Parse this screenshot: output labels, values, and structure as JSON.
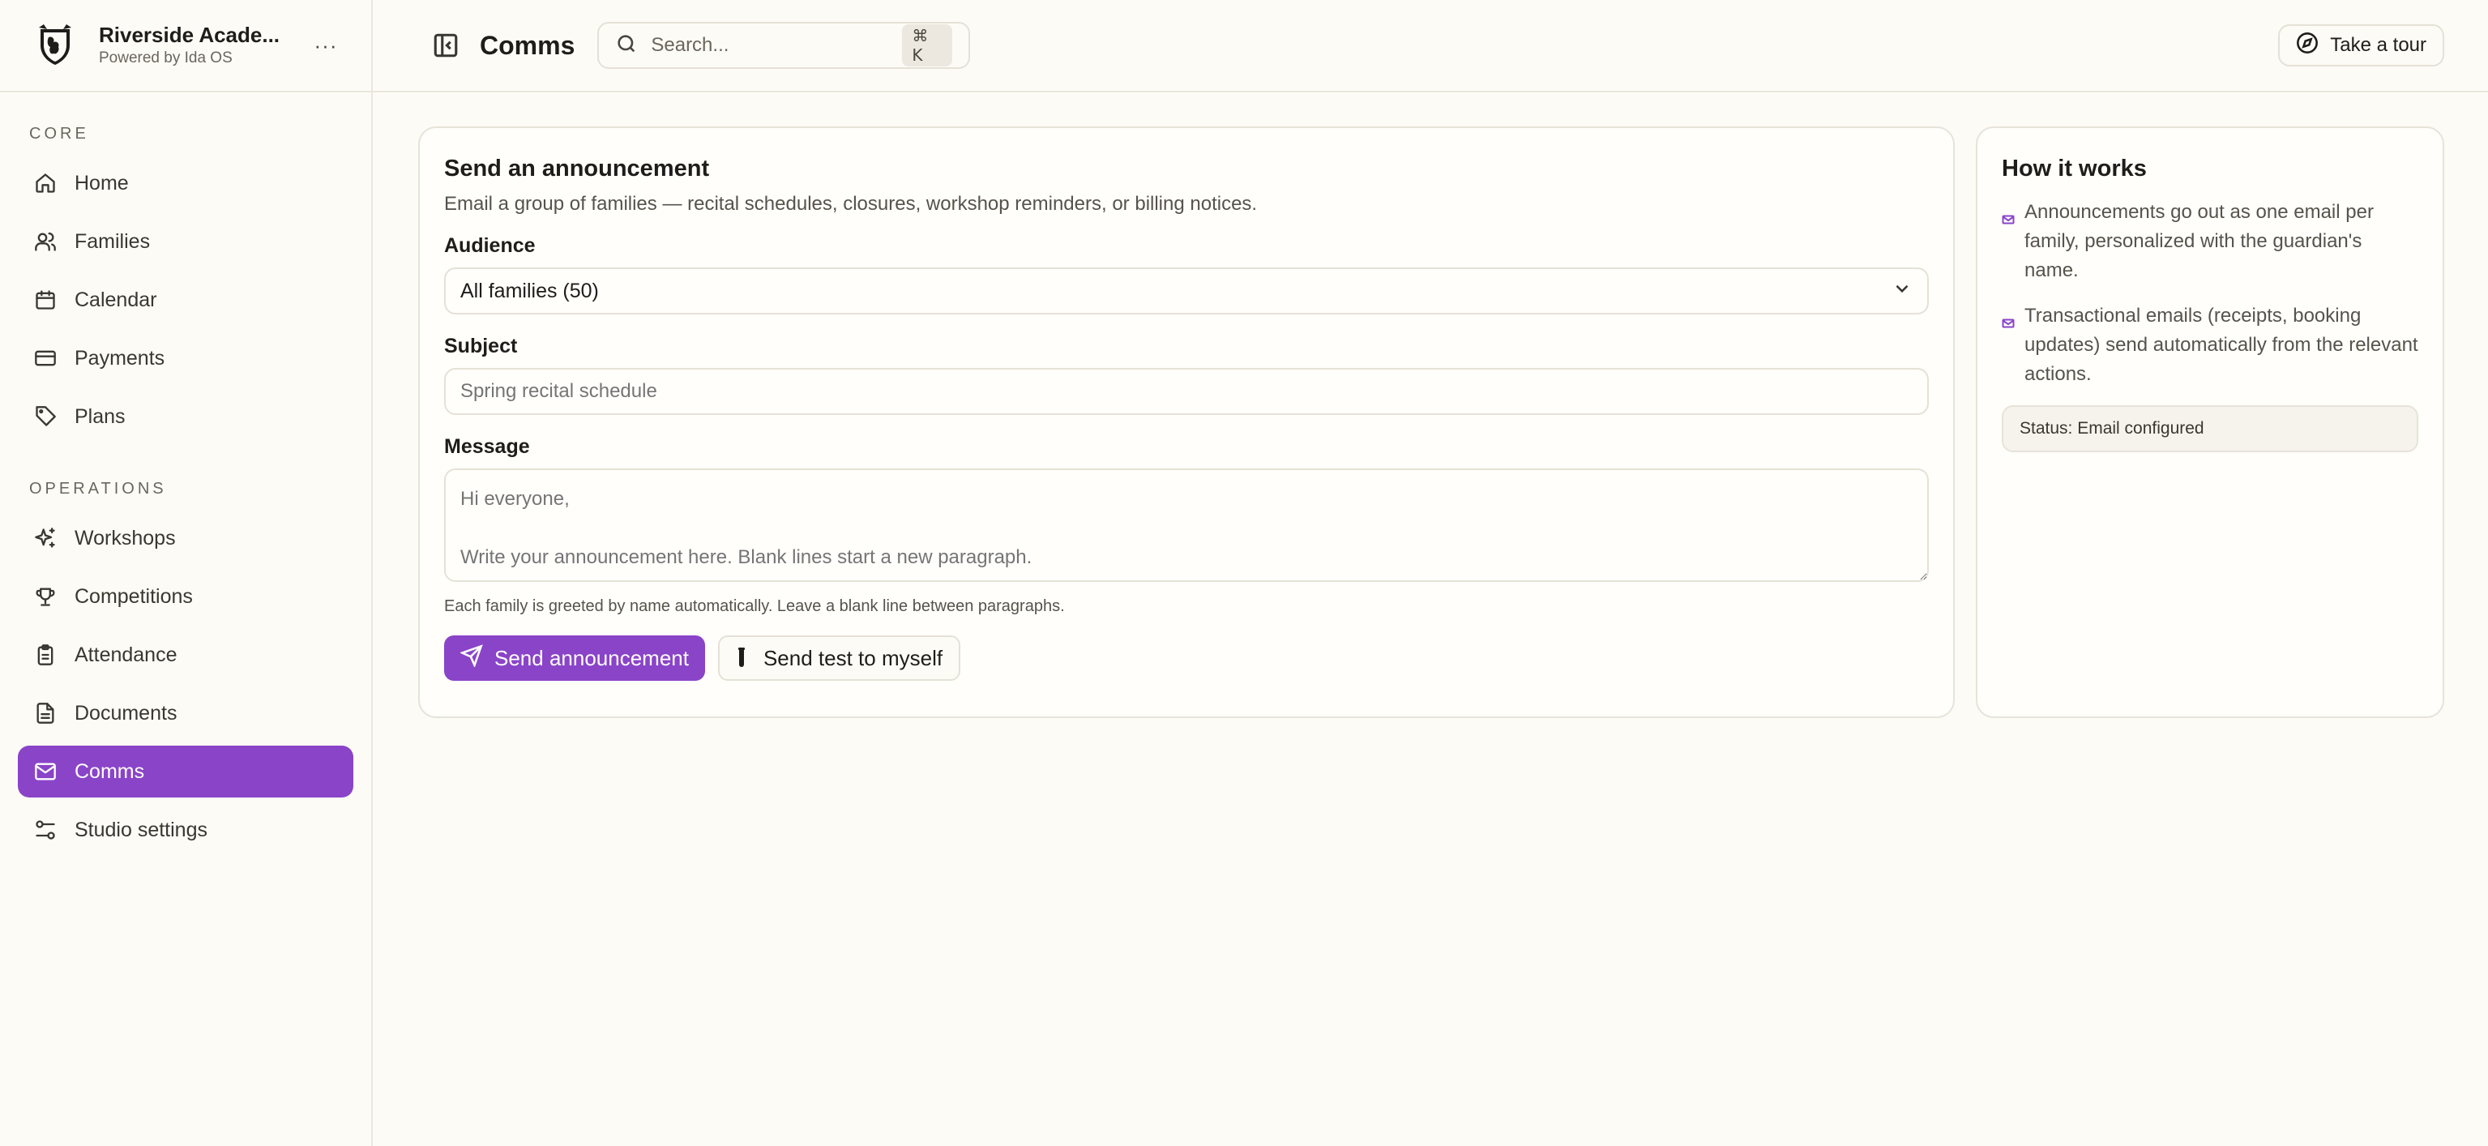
{
  "brand": {
    "name": "Riverside Acade...",
    "subtitle": "Powered by Ida OS",
    "more_label": "···"
  },
  "sidebar": {
    "core_label": "CORE",
    "core_items": [
      {
        "label": "Home",
        "icon": "home-icon"
      },
      {
        "label": "Families",
        "icon": "users-icon"
      },
      {
        "label": "Calendar",
        "icon": "calendar-icon"
      },
      {
        "label": "Payments",
        "icon": "credit-card-icon"
      },
      {
        "label": "Plans",
        "icon": "tag-icon"
      }
    ],
    "ops_label": "OPERATIONS",
    "ops_items": [
      {
        "label": "Workshops",
        "icon": "sparkles-icon"
      },
      {
        "label": "Competitions",
        "icon": "trophy-icon"
      },
      {
        "label": "Attendance",
        "icon": "clipboard-icon"
      },
      {
        "label": "Documents",
        "icon": "document-icon"
      },
      {
        "label": "Comms",
        "icon": "mail-icon",
        "active": true
      },
      {
        "label": "Studio settings",
        "icon": "sliders-icon"
      }
    ]
  },
  "header": {
    "title": "Comms",
    "search_placeholder": "Search...",
    "search_shortcut": "⌘ K",
    "tour_label": "Take a tour"
  },
  "announcement": {
    "title": "Send an announcement",
    "description": "Email a group of families — recital schedules, closures, workshop reminders, or billing notices.",
    "audience_label": "Audience",
    "audience_value": "All families (50)",
    "subject_label": "Subject",
    "subject_placeholder": "Spring recital schedule",
    "message_label": "Message",
    "message_placeholder": "Hi everyone,\n\nWrite your announcement here. Blank lines start a new paragraph.",
    "hint": "Each family is greeted by name automatically. Leave a blank line between paragraphs.",
    "send_label": "Send announcement",
    "test_label": "Send test to myself"
  },
  "how_it_works": {
    "title": "How it works",
    "items": [
      "Announcements go out as one email per family, personalized with the guardian's name.",
      "Transactional emails (receipts, booking updates) send automatically from the relevant actions."
    ],
    "status": "Status: Email configured"
  },
  "colors": {
    "accent": "#8a44c8",
    "background": "#fdfbf6",
    "border": "#e8e3d9"
  }
}
